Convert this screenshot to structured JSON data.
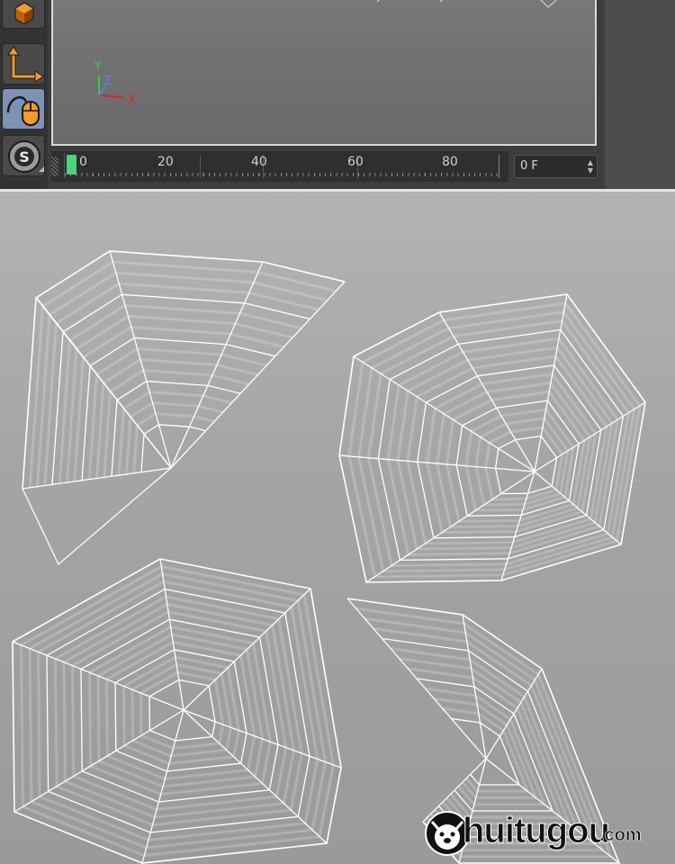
{
  "toolbar": {
    "tools": [
      {
        "name": "cube-object-icon"
      },
      {
        "name": "coordinate-axis-icon"
      },
      {
        "name": "mouse-navigation-icon"
      },
      {
        "name": "snap-icon",
        "label": "S"
      }
    ]
  },
  "viewport": {
    "axis": {
      "y": "Y",
      "z": "Z",
      "x": "X"
    },
    "colors": {
      "y": "#3cc94a",
      "z": "#5a7dff",
      "x": "#d8262b"
    }
  },
  "timeline": {
    "labels": [
      "0",
      "20",
      "40",
      "60",
      "80"
    ],
    "current_frame": "0 F"
  },
  "watermark": {
    "brand": "huitugou",
    "suffix": ".com"
  }
}
